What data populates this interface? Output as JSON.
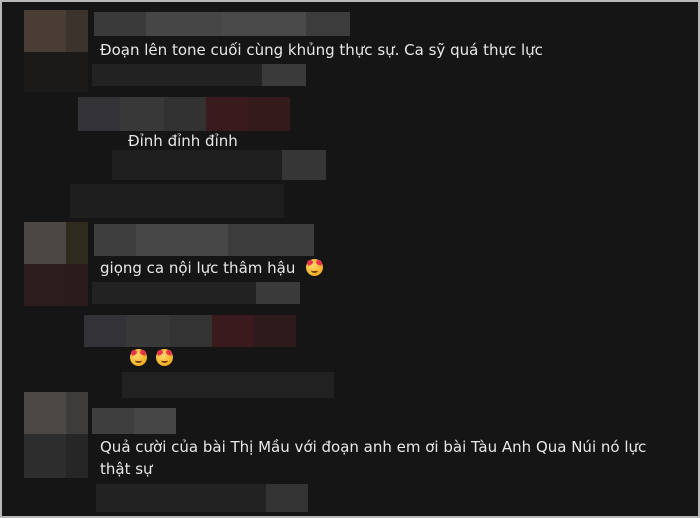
{
  "comments": [
    {
      "id": "c1",
      "text": "Đoạn lên tone cuối cùng khủng thực sự. Ca sỹ quá thực lực"
    },
    {
      "id": "r1",
      "text": "Đỉnh đỉnh đỉnh"
    },
    {
      "id": "c2",
      "text": "giọng ca nội lực thâm hậu"
    },
    {
      "id": "c3",
      "text": "Quả cười của bài Thị Mầu với đoạn anh em ơi bài Tàu Anh Qua Núi nó lực thật sự"
    }
  ],
  "icons": {
    "emoji": "smiling-face-with-hearts-icon",
    "avatar": "blurred-avatar"
  }
}
